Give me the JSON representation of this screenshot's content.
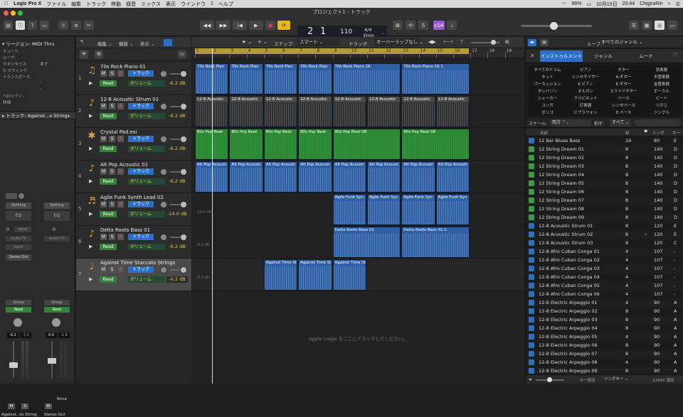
{
  "menubar": {
    "apple_icon": "apple-icon",
    "items": [
      "Logic Pro X",
      "ファイル",
      "編集",
      "トラック",
      "移動",
      "録音",
      "ミックス",
      "表示",
      "ウインドウ",
      "1",
      "ヘルプ"
    ],
    "status_battery": "96%",
    "status_date": "10月15日",
    "status_time": "20:44",
    "status_user": "ChigiraRin"
  },
  "window": {
    "title": "プロジェクト1 - トラック"
  },
  "lcd": {
    "bar": "2",
    "beat": "1",
    "bar_label": "小節",
    "beat_label": "拍",
    "tempo": "110",
    "tempo_label": "テンポ",
    "signature": "4/4",
    "key": "Emin"
  },
  "toolbar": {
    "count_in": "c14",
    "count_in_color": "#9b59d0"
  },
  "inspector": {
    "region_header": "リージョン:",
    "region_name": "MIDI Thru",
    "params": [
      {
        "label": "ミュート:",
        "value": ""
      },
      {
        "label": "ループ:",
        "value": ""
      },
      {
        "label": "クオンタイズ:",
        "value": "オフ"
      },
      {
        "label": "Q-スウィング:",
        "value": ""
      },
      {
        "label": "トランスポーズ:",
        "value": ""
      },
      {
        "label": "",
        "value": "-"
      },
      {
        "label": "",
        "value": "-"
      },
      {
        "label": "ベロシティ:",
        "value": ""
      },
      {
        "label": "詳細",
        "value": ""
      }
    ],
    "track_header": "トラック:",
    "track_name": "Against...o Strings",
    "strip1": {
      "setting": "Setting",
      "eq": "EQ",
      "input": "Input",
      "audio_fx": "Audio FX",
      "send": "Send",
      "output": "Stereo Out",
      "group": "Group",
      "read": "Read",
      "val1": "-6.2",
      "val2": "-7.2",
      "mute": "M",
      "solo": "S",
      "name": "Against...to Strings"
    },
    "strip2": {
      "setting": "Setting",
      "eq": "EQ",
      "audio_fx": "Audio FX",
      "group": "Group",
      "read": "Read",
      "val1": "0.0",
      "val2": "-1.5",
      "mute": "M",
      "bnce": "Bnce",
      "name": "Stereo Out"
    }
  },
  "tracklist_header": {
    "edit": "編集",
    "func": "機能",
    "view": "表示"
  },
  "tracks": [
    {
      "num": "1",
      "name": "70s Rock Piano 01",
      "volume_label": "ボリューム",
      "db": "-6.2 dB",
      "track_label": "トラック",
      "read": "Read",
      "m": "M",
      "s": "S",
      "r": "R",
      "selected": false
    },
    {
      "num": "2",
      "name": "12-8 Acoustic Strum 01",
      "volume_label": "ボリューム",
      "db": "-6.2 dB",
      "track_label": "トラック",
      "read": "Read",
      "m": "M",
      "s": "S",
      "r": "R",
      "selected": false
    },
    {
      "num": "3",
      "name": "Crystal Pad.esi",
      "volume_label": "ボリューム",
      "db": "-6.2 dB",
      "track_label": "トラック",
      "read": "Read",
      "m": "M",
      "s": "S",
      "r": "R",
      "selected": false
    },
    {
      "num": "4",
      "name": "Alt Pop Acoustic 01",
      "volume_label": "ボリューム",
      "db": "-6.2 dB",
      "track_label": "トラック",
      "read": "Read",
      "m": "M",
      "s": "S",
      "r": "R",
      "selected": false
    },
    {
      "num": "5",
      "name": "Agile Funk Synth Lead 02",
      "volume_label": "ボリューム",
      "db": "-14.0 dB",
      "track_label": "トラック",
      "read": "Read",
      "m": "M",
      "s": "S",
      "r": "R",
      "selected": false
    },
    {
      "num": "6",
      "name": "Delta Roots Bass 01",
      "volume_label": "ボリューム",
      "db": "-6.2 dB",
      "track_label": "トラック",
      "read": "Read",
      "m": "M",
      "s": "S",
      "r": "R",
      "selected": false
    },
    {
      "num": "7",
      "name": "Against Time Staccato Strings",
      "volume_label": "ボリューム",
      "db": "-6.2 dB",
      "track_label": "トラック",
      "read": "Read",
      "m": "M",
      "s": "S",
      "r": "R",
      "selected": true
    }
  ],
  "arrange": {
    "snap_label": "スナップ:",
    "snap_value": "スマート",
    "drag_label": "ドラッグ:",
    "drag_value": "オーバーラップなし",
    "ruler": [
      "1",
      "2",
      "3",
      "4",
      "5",
      "6",
      "7",
      "8",
      "9",
      "10",
      "11",
      "12",
      "13",
      "14",
      "15",
      "16",
      "17",
      "18",
      "19"
    ],
    "drop_hint": "Apple Loops をここにドラッグしてください。",
    "db_marks": [
      "-14.0 dB",
      "-6.2 dB",
      "-6.2 dB"
    ],
    "rows": [
      {
        "color": "#2f5fa6",
        "regions": [
          {
            "label": "70s Rock Pian"
          },
          {
            "label": "70s Rock Pian"
          },
          {
            "label": "70s Rock Pian"
          },
          {
            "label": "70s Rock Pian"
          },
          {
            "label": "70s Rock Piano 16"
          },
          {
            "label": "70s Rock Piano 16.1"
          }
        ]
      },
      {
        "color": "#3a3a3a",
        "regions": [
          {
            "label": "12-8 Acoustic"
          },
          {
            "label": "12-8 Acoustic"
          },
          {
            "label": "12-8 Acoustic"
          },
          {
            "label": "12-8 Acoustic"
          },
          {
            "label": "12-8 Acoustic"
          },
          {
            "label": "12-8 Acoustic"
          },
          {
            "label": "12-8 Acoustic"
          },
          {
            "label": "12-8 Acoustic"
          }
        ]
      },
      {
        "color": "#2c8a35",
        "regions": [
          {
            "label": "80s Pop Beat"
          },
          {
            "label": "80s Pop Beat"
          },
          {
            "label": "80s Pop Beat"
          },
          {
            "label": "80s Pop Beat"
          },
          {
            "label": "80s Pop Beat 08"
          },
          {
            "label": "80s Pop Beat 08"
          }
        ]
      },
      {
        "color": "#2f5fa6",
        "regions": [
          {
            "label": "Alt Pop Acousti"
          },
          {
            "label": "Alt Pop Acousti"
          },
          {
            "label": "Alt Pop Acousti"
          },
          {
            "label": "Alt Pop Acousti"
          },
          {
            "label": "Alt Pop Acousti"
          },
          {
            "label": "Alt Pop Acousti"
          },
          {
            "label": "Alt Pop Acousti"
          },
          {
            "label": "Alt Pop Acousti"
          }
        ]
      },
      {
        "color": "#2f5fa6",
        "regions": [
          {
            "label": "Agile Funk Syn"
          },
          {
            "label": "Agile Funk Syn"
          },
          {
            "label": "Agile Funk Syn"
          },
          {
            "label": "Agile Funk Syn"
          }
        ]
      },
      {
        "color": "#2f5fa6",
        "regions": [
          {
            "label": "Delta Roots Bass 01"
          },
          {
            "label": "Delta Roots Bass 01.1"
          }
        ]
      },
      {
        "color": "#2f5fa6",
        "regions": [
          {
            "label": "Against Time Sta"
          },
          {
            "label": "Against Time Sta"
          },
          {
            "label": "Against Time Sta"
          }
        ]
      }
    ]
  },
  "browser": {
    "loop_label": "ループ:",
    "loop_value": "すべてのジャンル",
    "tabs": [
      "インストゥルメント",
      "ジャンル",
      "ムード"
    ],
    "categories": [
      [
        "すべてのドラム",
        "ピアノ",
        "ギター",
        "弦楽器"
      ],
      [
        "キット",
        "シンセサイザー",
        "A.ギター",
        "木管楽器"
      ],
      [
        "パーカッション",
        "E.ピアノ",
        "E.ギター",
        "金管楽器"
      ],
      [
        "タンバリン",
        "オルガン",
        "スライドギター",
        "ボーカル"
      ],
      [
        "シェーカー",
        "クラビネット",
        "ベース",
        "ビート"
      ],
      [
        "コンガ",
        "打楽器",
        "シンセベース",
        "効果音"
      ],
      [
        "ボンゴ",
        "ビブラフォン",
        "E.ベース",
        "ジングル"
      ]
    ],
    "scale_label": "スケール:",
    "scale_value": "両方",
    "beat_label": "拍子:",
    "beat_value": "すべて",
    "col_name": "名前",
    "col_beats": "拍",
    "col_tempo": "テンポ",
    "col_key": "キー",
    "rows": [
      {
        "name": "12 Bar Blues Bass",
        "beats": "16",
        "fav": "",
        "tempo": "80",
        "key": "E",
        "type": "audio"
      },
      {
        "name": "12 String Dream 01",
        "beats": "8",
        "fav": "",
        "tempo": "140",
        "key": "D",
        "type": "midi"
      },
      {
        "name": "12 String Dream 02",
        "beats": "8",
        "fav": "",
        "tempo": "140",
        "key": "D",
        "type": "midi"
      },
      {
        "name": "12 String Dream 03",
        "beats": "8",
        "fav": "",
        "tempo": "140",
        "key": "D",
        "type": "midi"
      },
      {
        "name": "12 String Dream 04",
        "beats": "8",
        "fav": "",
        "tempo": "140",
        "key": "D",
        "type": "midi"
      },
      {
        "name": "12 String Dream 05",
        "beats": "8",
        "fav": "",
        "tempo": "140",
        "key": "D",
        "type": "midi"
      },
      {
        "name": "12 String Dream 06",
        "beats": "8",
        "fav": "",
        "tempo": "140",
        "key": "D",
        "type": "midi"
      },
      {
        "name": "12 String Dream 07",
        "beats": "8",
        "fav": "",
        "tempo": "140",
        "key": "D",
        "type": "midi"
      },
      {
        "name": "12 String Dream 08",
        "beats": "8",
        "fav": "",
        "tempo": "140",
        "key": "D",
        "type": "midi"
      },
      {
        "name": "12 String Dream 09",
        "beats": "8",
        "fav": "",
        "tempo": "140",
        "key": "D",
        "type": "midi"
      },
      {
        "name": "12-8 Acoustic Strum 01",
        "beats": "8",
        "fav": "",
        "tempo": "120",
        "key": "E",
        "type": "audio"
      },
      {
        "name": "12-8 Acoustic Strum 02",
        "beats": "8",
        "fav": "✓",
        "tempo": "120",
        "key": "E",
        "type": "audio"
      },
      {
        "name": "12-8 Acoustic Strum 03",
        "beats": "8",
        "fav": "",
        "tempo": "120",
        "key": "C",
        "type": "audio"
      },
      {
        "name": "12-8 Afro Cuban Conga 01",
        "beats": "4",
        "fav": "",
        "tempo": "107",
        "key": "-",
        "type": "audio"
      },
      {
        "name": "12-8 Afro Cuban Conga 02",
        "beats": "4",
        "fav": "",
        "tempo": "107",
        "key": "-",
        "type": "audio"
      },
      {
        "name": "12-8 Afro Cuban Conga 03",
        "beats": "4",
        "fav": "",
        "tempo": "107",
        "key": "-",
        "type": "audio"
      },
      {
        "name": "12-8 Afro Cuban Conga 04",
        "beats": "4",
        "fav": "",
        "tempo": "107",
        "key": "-",
        "type": "audio"
      },
      {
        "name": "12-8 Afro Cuban Conga 05",
        "beats": "4",
        "fav": "",
        "tempo": "107",
        "key": "-",
        "type": "audio"
      },
      {
        "name": "12-8 Afro Cuban Conga 06",
        "beats": "4",
        "fav": "",
        "tempo": "107",
        "key": "-",
        "type": "audio"
      },
      {
        "name": "12-8 Electric Arpeggio 01",
        "beats": "4",
        "fav": "",
        "tempo": "90",
        "key": "A",
        "type": "audio"
      },
      {
        "name": "12-8 Electric Arpeggio 02",
        "beats": "8",
        "fav": "",
        "tempo": "90",
        "key": "A",
        "type": "audio"
      },
      {
        "name": "12-8 Electric Arpeggio 03",
        "beats": "8",
        "fav": "",
        "tempo": "90",
        "key": "A",
        "type": "audio"
      },
      {
        "name": "12-8 Electric Arpeggio 04",
        "beats": "8",
        "fav": "",
        "tempo": "90",
        "key": "A",
        "type": "audio"
      },
      {
        "name": "12-8 Electric Arpeggio 05",
        "beats": "4",
        "fav": "",
        "tempo": "90",
        "key": "A",
        "type": "audio"
      },
      {
        "name": "12-8 Electric Arpeggio 06",
        "beats": "8",
        "fav": "",
        "tempo": "90",
        "key": "A",
        "type": "audio"
      },
      {
        "name": "12-8 Electric Arpeggio 07",
        "beats": "8",
        "fav": "",
        "tempo": "90",
        "key": "A",
        "type": "audio"
      },
      {
        "name": "12-8 Electric Arpeggio 08",
        "beats": "4",
        "fav": "",
        "tempo": "90",
        "key": "A",
        "type": "audio"
      },
      {
        "name": "12-8 Electric Arpeggio 09",
        "beats": "8",
        "fav": "",
        "tempo": "90",
        "key": "A",
        "type": "audio"
      }
    ],
    "footer_key_label": "キー設定",
    "footer_songkey": "ソングキー",
    "footer_count": "22940 項目"
  }
}
